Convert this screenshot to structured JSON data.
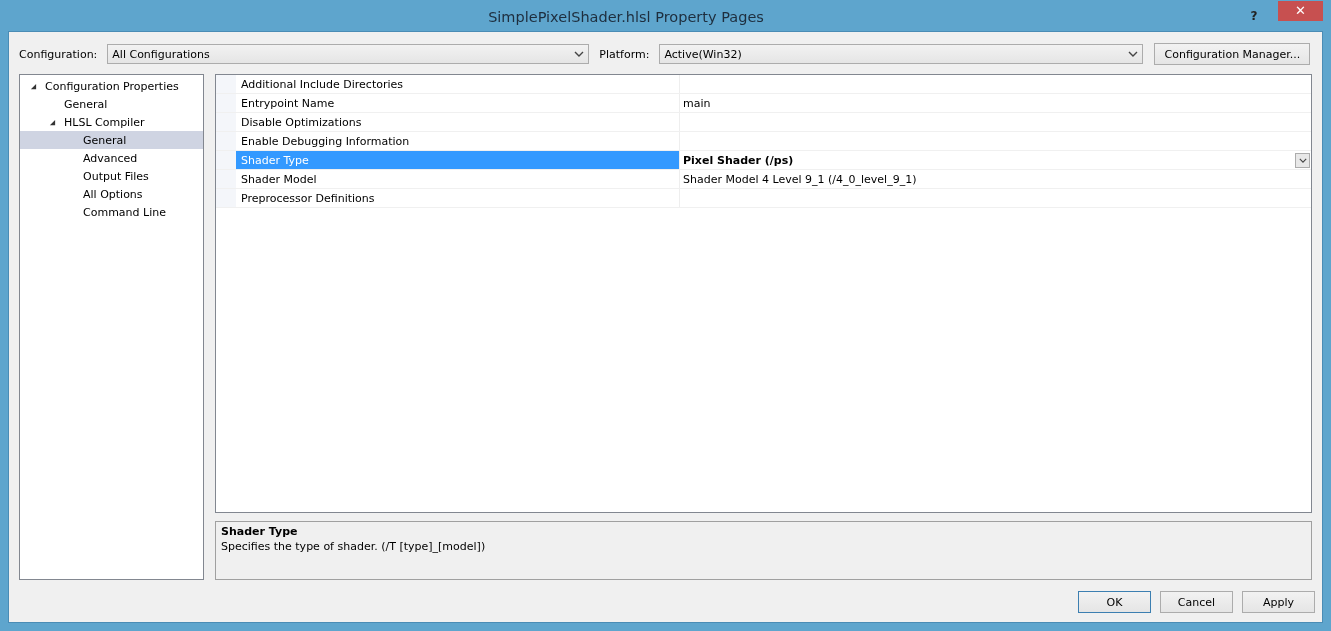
{
  "window": {
    "title": "SimplePixelShader.hlsl Property Pages",
    "help": "?",
    "close": "✕"
  },
  "toolbar": {
    "configuration_label": "Configuration:",
    "configuration": "All Configurations",
    "platform_label": "Platform:",
    "platform": "Active(Win32)",
    "manager_button": "Configuration Manager..."
  },
  "tree": [
    {
      "label": "Configuration Properties",
      "expanded": true,
      "selected": false,
      "children": [
        {
          "label": "General",
          "selected": false
        },
        {
          "label": "HLSL Compiler",
          "expanded": true,
          "selected": false,
          "children": [
            {
              "label": "General",
              "selected": true
            },
            {
              "label": "Advanced",
              "selected": false
            },
            {
              "label": "Output Files",
              "selected": false
            },
            {
              "label": "All Options",
              "selected": false
            },
            {
              "label": "Command Line",
              "selected": false
            }
          ]
        }
      ]
    }
  ],
  "properties": [
    {
      "name": "Additional Include Directories",
      "selected": false
    },
    {
      "name": "Entrypoint Name",
      "value": "main",
      "selected": false,
      "modified": false
    },
    {
      "name": "Disable Optimizations",
      "selected": false
    },
    {
      "name": "Enable Debugging Information",
      "selected": false
    },
    {
      "name": "Shader Type",
      "value": "Pixel Shader (/ps)",
      "selected": true,
      "modified": true
    },
    {
      "name": "Shader Model",
      "value": "Shader Model 4 Level 9_1 (/4_0_level_9_1)",
      "selected": false,
      "modified": false
    },
    {
      "name": "Preprocessor Definitions",
      "selected": false
    }
  ],
  "description": {
    "title": "Shader Type",
    "text": "Specifies the type of shader.  (/T [type]_[model])"
  },
  "buttons": [
    {
      "label": "OK",
      "default": true
    },
    {
      "label": "Cancel",
      "default": false
    },
    {
      "label": "Apply",
      "default": false
    }
  ]
}
